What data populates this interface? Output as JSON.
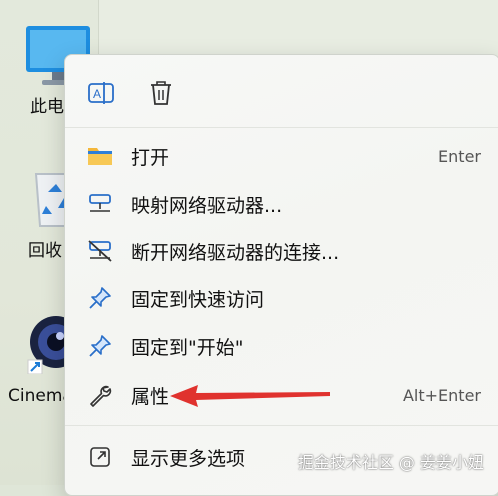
{
  "desktop": {
    "icons": [
      {
        "label": "此电"
      },
      {
        "label": "回收"
      },
      {
        "label": "Cinema"
      }
    ]
  },
  "context_menu": {
    "top_actions": [
      {
        "icon": "rename-icon"
      },
      {
        "icon": "delete-icon"
      }
    ],
    "items": [
      {
        "label": "打开",
        "shortcut": "Enter",
        "icon": "folder-icon"
      },
      {
        "label": "映射网络驱动器...",
        "shortcut": "",
        "icon": "network-drive-icon"
      },
      {
        "label": "断开网络驱动器的连接...",
        "shortcut": "",
        "icon": "disconnect-drive-icon"
      },
      {
        "label": "固定到快速访问",
        "shortcut": "",
        "icon": "pin-icon"
      },
      {
        "label": "固定到\"开始\"",
        "shortcut": "",
        "icon": "pin-start-icon"
      },
      {
        "label": "属性",
        "shortcut": "Alt+Enter",
        "icon": "wrench-icon"
      },
      {
        "label": "显示更多选项",
        "shortcut": "",
        "icon": "more-options-icon"
      }
    ]
  },
  "annotation": {
    "arrow_color": "#e0322e"
  },
  "watermark": "掘金技术社区 @ 姜姜小妞"
}
